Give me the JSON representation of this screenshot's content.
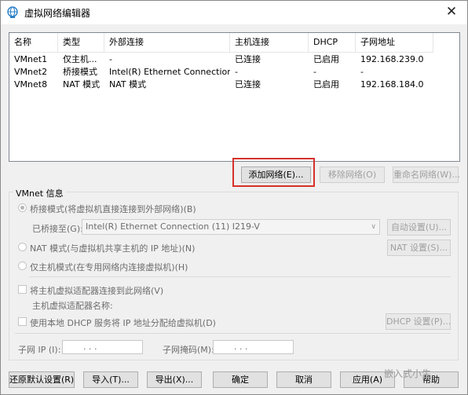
{
  "window": {
    "title": "虚拟网络编辑器",
    "close": "✕"
  },
  "list": {
    "headers": [
      "名称",
      "类型",
      "外部连接",
      "主机连接",
      "DHCP",
      "子网地址"
    ],
    "rows": [
      [
        "VMnet1",
        "仅主机...",
        "-",
        "已连接",
        "已启用",
        "192.168.239.0"
      ],
      [
        "VMnet2",
        "桥接模式",
        "Intel(R) Ethernet Connection (...",
        "-",
        "-",
        "-"
      ],
      [
        "VMnet8",
        "NAT 模式",
        "NAT 模式",
        "已连接",
        "已启用",
        "192.168.184.0"
      ]
    ]
  },
  "list_buttons": {
    "add": "添加网络(E)...",
    "remove": "移除网络(O)",
    "rename": "重命名网络(W)..."
  },
  "info": {
    "group_label": "VMnet 信息",
    "bridge_radio": "桥接模式(将虚拟机直接连接到外部网络)(B)",
    "bridge_to_label": "已桥接至(G):",
    "bridge_to_value": "Intel(R) Ethernet Connection (11) I219-V",
    "auto_btn": "自动设置(U)...",
    "nat_radio": "NAT 模式(与虚拟机共享主机的 IP 地址)(N)",
    "nat_btn": "NAT 设置(S)...",
    "host_radio": "仅主机模式(在专用网络内连接虚拟机)(H)",
    "connect_check": "将主机虚拟适配器连接到此网络(V)",
    "adapter_name_label": "主机虚拟适配器名称:",
    "dhcp_check": "使用本地 DHCP 服务将 IP 地址分配给虚拟机(D)",
    "dhcp_btn": "DHCP 设置(P)...",
    "subnet_ip_label": "子网 IP (I):",
    "subnet_ip_value": ".     .     .",
    "mask_label": "子网掩码(M):",
    "mask_value": ".     .     ."
  },
  "footer": {
    "restore": "还原默认设置(R)",
    "import": "导入(T)...",
    "export": "导出(X)...",
    "ok": "确定",
    "cancel": "取消",
    "apply": "应用(A)",
    "help": "帮助"
  },
  "watermark": "嵌入式小生",
  "colors": {
    "highlight": "#d6302a",
    "icon": "#2a7fc6"
  }
}
